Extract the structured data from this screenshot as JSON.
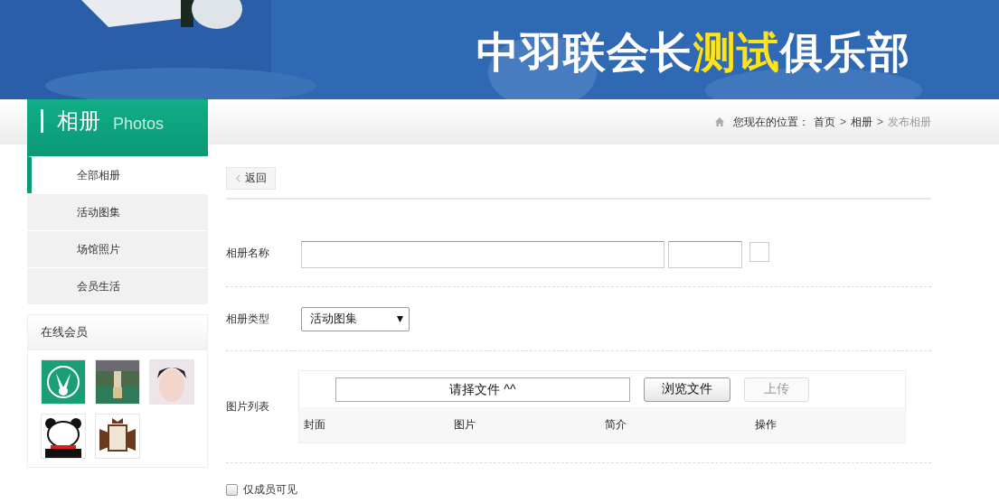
{
  "banner": {
    "title": [
      {
        "text": "中羽联会长",
        "highlight": false
      },
      {
        "text": "测试",
        "highlight": true
      },
      {
        "text": "俱乐部",
        "highlight": false
      }
    ]
  },
  "breadcrumb": {
    "prefix": "您现在的位置：",
    "items": [
      {
        "text": "首页",
        "current": false
      },
      {
        "text": "相册",
        "current": false
      },
      {
        "text": "发布相册",
        "current": true
      }
    ],
    "separator": ">"
  },
  "sidebar": {
    "title": "相册",
    "subtitle": "Photos",
    "items": [
      {
        "label": "全部相册",
        "selected": true
      },
      {
        "label": "活动图集",
        "selected": false
      },
      {
        "label": "场馆照片",
        "selected": false
      },
      {
        "label": "会员生活",
        "selected": false
      }
    ]
  },
  "online_members": {
    "title": "在线会员"
  },
  "back_button": {
    "label": "返回"
  },
  "form": {
    "name_label": "相册名称",
    "type_label": "相册类型",
    "type_value": "活动图集",
    "list_label": "图片列表",
    "file_field": {
      "value": "请择文件 ^^"
    },
    "browse_button": {
      "label": "浏览文件",
      "disabled": false
    },
    "upload_button": {
      "label": "上传",
      "disabled": true
    },
    "columns": [
      "封面",
      "图片",
      "简介",
      "操作"
    ],
    "members_only": {
      "label": "仅成员可见",
      "checked": false
    }
  }
}
